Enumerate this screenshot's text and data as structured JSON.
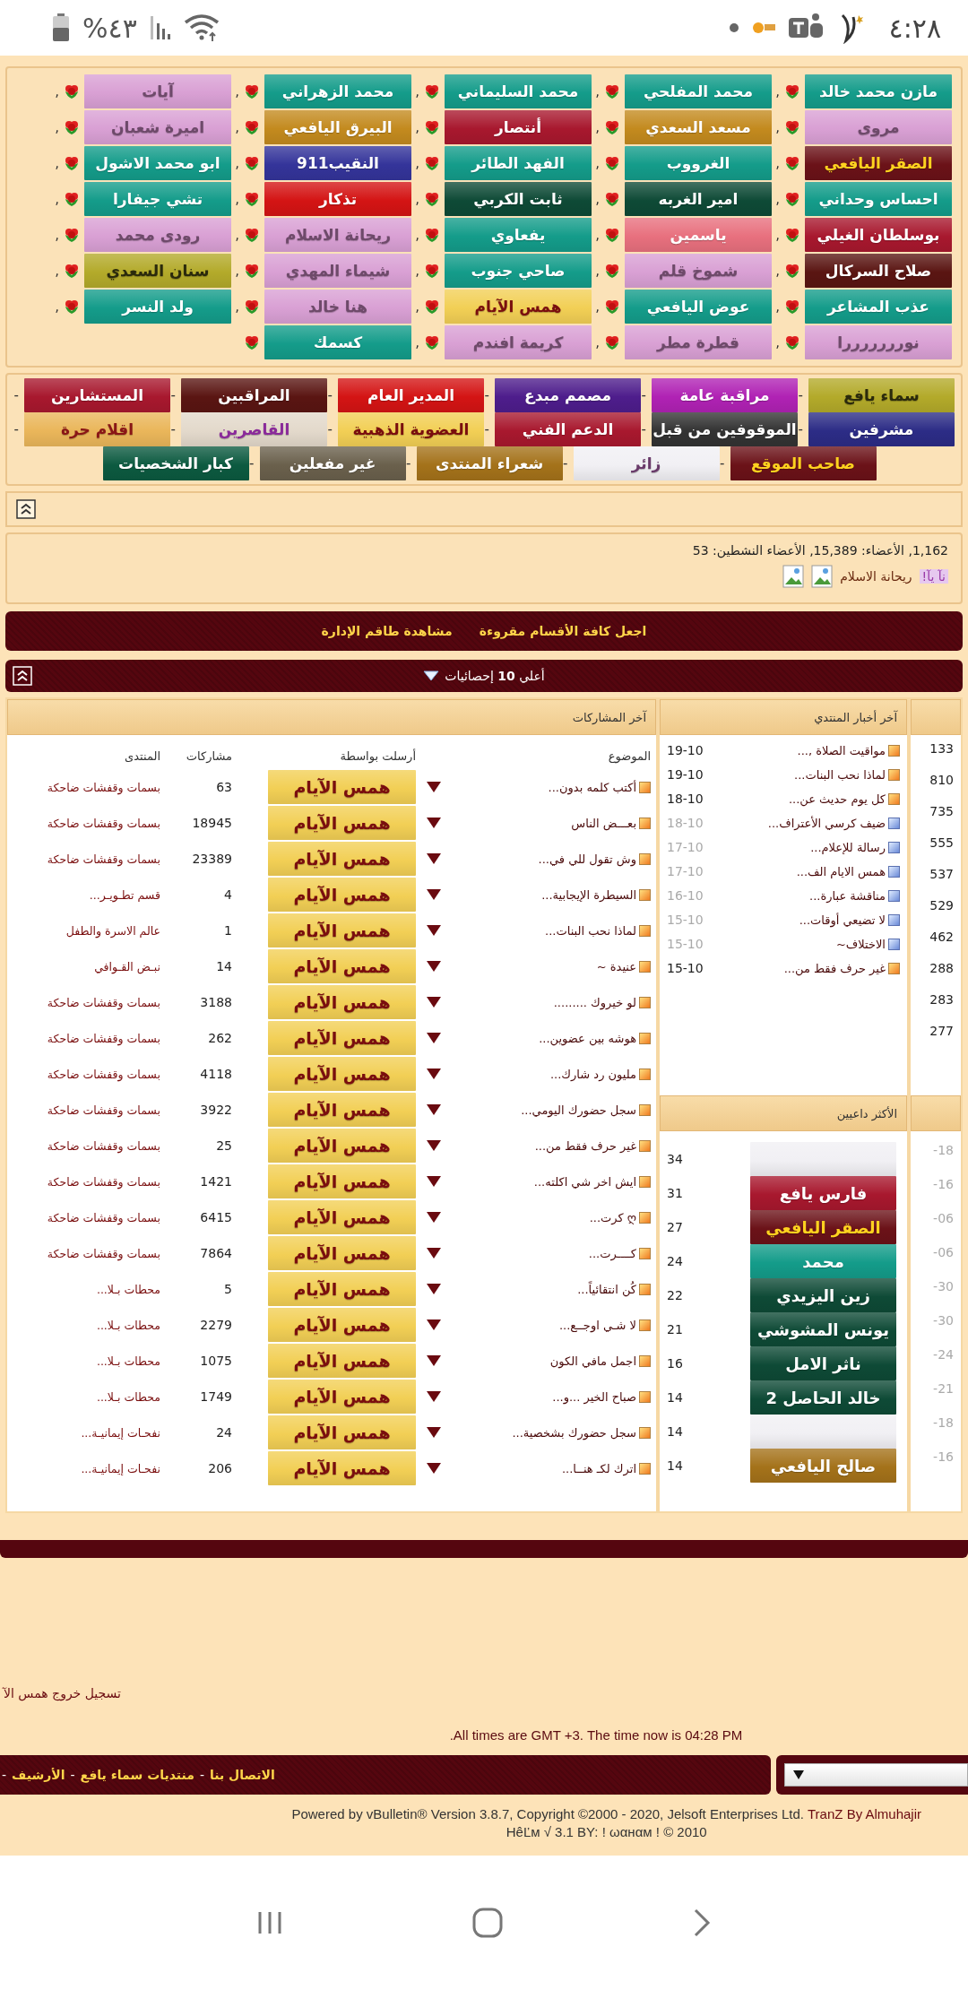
{
  "status_bar": {
    "battery": "%٤٣",
    "time": "٤:٢٨"
  },
  "online_users": [
    {
      "name": "مازن محمد خالد",
      "kind": "teal",
      "sep": ","
    },
    {
      "name": "محمد المفلحي",
      "kind": "teal",
      "sep": ","
    },
    {
      "name": "محمد السليماني",
      "kind": "teal",
      "sep": ","
    },
    {
      "name": "محمد الزهراني",
      "kind": "teal",
      "sep": ","
    },
    {
      "name": "آيات",
      "kind": "pink",
      "sep": ","
    },
    {
      "name": "مروى",
      "kind": "pink",
      "sep": ","
    },
    {
      "name": "مسعد السعدي",
      "kind": "amber",
      "sep": ","
    },
    {
      "name": "أنتصار",
      "kind": "crimson",
      "sep": ","
    },
    {
      "name": "البيرق اليافعي",
      "kind": "amber",
      "sep": ","
    },
    {
      "name": "اميرة شعبان",
      "kind": "pink",
      "sep": ","
    },
    {
      "name": "الصقر اليافعي",
      "kind": "maroon",
      "sep": ","
    },
    {
      "name": "الغرووب",
      "kind": "teal",
      "sep": ","
    },
    {
      "name": "الفهد الطائر",
      "kind": "teal",
      "sep": ","
    },
    {
      "name": "النقيب911",
      "kind": "indigo",
      "sep": ","
    },
    {
      "name": "ابو محمد الاشول",
      "kind": "teal",
      "sep": ","
    },
    {
      "name": "احساس وحداني",
      "kind": "teal",
      "sep": ","
    },
    {
      "name": "امير الغربه",
      "kind": "forest",
      "sep": ","
    },
    {
      "name": "ثابت الكربي",
      "kind": "forest",
      "sep": ","
    },
    {
      "name": "تذكار",
      "kind": "red",
      "sep": ","
    },
    {
      "name": "تشي جيفارا",
      "kind": "teal",
      "sep": ","
    },
    {
      "name": "بوسلطان الغيلي",
      "kind": "crimson",
      "sep": ","
    },
    {
      "name": "ياسمين",
      "kind": "coral",
      "sep": ","
    },
    {
      "name": "يفعاوي",
      "kind": "teal",
      "sep": ","
    },
    {
      "name": "ريحانة الاسلام",
      "kind": "pink",
      "sep": ","
    },
    {
      "name": "رودى محمد",
      "kind": "pink",
      "sep": ","
    },
    {
      "name": "صلاح السركال",
      "kind": "wine",
      "sep": ","
    },
    {
      "name": "شموخ قلم",
      "kind": "pink",
      "sep": ","
    },
    {
      "name": "صاحي جنوب",
      "kind": "teal",
      "sep": ","
    },
    {
      "name": "شيماء المهدي",
      "kind": "pink",
      "sep": ","
    },
    {
      "name": "سنان السعدي",
      "kind": "olive",
      "sep": ","
    },
    {
      "name": "عذب المشاعر",
      "kind": "teal",
      "sep": ","
    },
    {
      "name": "عوض اليافعي",
      "kind": "teal",
      "sep": ","
    },
    {
      "name": "همس الآيام",
      "kind": "gold",
      "sep": ","
    },
    {
      "name": "هنا خالد",
      "kind": "pink",
      "sep": ","
    },
    {
      "name": "ولد النسر",
      "kind": "teal",
      "sep": ","
    },
    {
      "name": "نورررررررا",
      "kind": "pink",
      "sep": ","
    },
    {
      "name": "قطرة مطر",
      "kind": "pink",
      "sep": ","
    },
    {
      "name": "كريمة افندم",
      "kind": "pink",
      "sep": ","
    },
    {
      "name": "كسمك",
      "kind": "teal"
    }
  ],
  "usergroups": [
    {
      "name": "سماء يافع",
      "kind": "olive",
      "sep": "-"
    },
    {
      "name": "مراقبة عامة",
      "kind": "magenta",
      "sep": "-"
    },
    {
      "name": "مصمم مبدع",
      "kind": "purple",
      "sep": "-"
    },
    {
      "name": "المدير العام",
      "kind": "red",
      "sep": "-"
    },
    {
      "name": "المراقبين",
      "kind": "wine",
      "sep": "-"
    },
    {
      "name": "المستشارين",
      "kind": "crimson",
      "sep": "-"
    },
    {
      "name": "مشرفين",
      "kind": "navy",
      "sep": "-"
    },
    {
      "name": "الموقوفين من قبل",
      "kind": "black",
      "sep": "-"
    },
    {
      "name": "الدعم الفني",
      "kind": "crimson",
      "sep": "-"
    },
    {
      "name": "العضوية الذهبية",
      "kind": "gold",
      "sep": "-"
    },
    {
      "name": "القاصرين",
      "kind": "beige",
      "sep": "-"
    },
    {
      "name": "اقلام حرة",
      "kind": "sand",
      "sep": "-"
    },
    {
      "name": "صاحب الموقع",
      "kind": "maroon",
      "sep": "-"
    },
    {
      "name": "زائر",
      "kind": "white",
      "sep": "-"
    },
    {
      "name": "شعراء المنتدى",
      "kind": "bronze",
      "sep": "-"
    },
    {
      "name": "غير مفعلين",
      "kind": "taupe",
      "sep": "-"
    },
    {
      "name": "كبار الشخصيات",
      "kind": "emerald"
    }
  ],
  "stats": {
    "text": "1,162, الأعضاء: 15,389, الأعضاء النشطين: 53",
    "highlight_name": "نآ يآ!",
    "name": "ريحانة الاسلام"
  },
  "action_links": [
    "اجعل كافة الأقسام مقروءة",
    "مشاهدة طاقم الإدارة"
  ],
  "top_stats": {
    "title": "أعلي **10** إحصائيات"
  },
  "latest_posts": {
    "title": "آخر المشاركات",
    "columns": [
      "الموضوع",
      "أرسلت بواسطة",
      "مشاركات",
      "المنتدى"
    ],
    "rows": [
      {
        "topic": "أكتب كلمه بدون...",
        "poster": "همس الآيام",
        "posts": "63",
        "forum": "بسمات وقفشات ضاحكة"
      },
      {
        "topic": "بعـــض الناس",
        "poster": "همس الآيام",
        "posts": "18945",
        "forum": "بسمات وقفشات ضاحكة"
      },
      {
        "topic": "وش تقول للي في...",
        "poster": "همس الآيام",
        "posts": "23389",
        "forum": "بسمات وقفشات ضاحكة"
      },
      {
        "topic": "السيطرة الإيجابية...",
        "poster": "همس الآيام",
        "posts": "4",
        "forum": "قسم تطـويـر..."
      },
      {
        "topic": "لماذا نحب البنات...",
        "poster": "همس الآيام",
        "posts": "1",
        "forum": "عالم الاسرة والطفل"
      },
      {
        "topic": "عنيدة ~",
        "poster": "همس الآيام",
        "posts": "14",
        "forum": "نبـض القـوافي"
      },
      {
        "topic": "لو خيروك .........",
        "poster": "همس الآيام",
        "posts": "3188",
        "forum": "بسمات وقفشات ضاحكة"
      },
      {
        "topic": "هوشه بين عضوين...",
        "poster": "همس الآيام",
        "posts": "262",
        "forum": "بسمات وقفشات ضاحكة"
      },
      {
        "topic": "مليون رد شارك...",
        "poster": "همس الآيام",
        "posts": "4118",
        "forum": "بسمات وقفشات ضاحكة"
      },
      {
        "topic": "سجل حضورك اليومي...",
        "poster": "همس الآيام",
        "posts": "3922",
        "forum": "بسمات وقفشات ضاحكة"
      },
      {
        "topic": "غير حرف فقط من...",
        "poster": "همس الآيام",
        "posts": "25",
        "forum": "بسمات وقفشات ضاحكة"
      },
      {
        "topic": "ايش اخر شي اكلته...",
        "poster": "همس الآيام",
        "posts": "1421",
        "forum": "بسمات وقفشات ضاحكة"
      },
      {
        "topic": "ღ كرت...",
        "poster": "همس الآيام",
        "posts": "6415",
        "forum": "بسمات وقفشات ضاحكة"
      },
      {
        "topic": "كــــرت...",
        "poster": "همس الآيام",
        "posts": "7864",
        "forum": "بسمات وقفشات ضاحكة"
      },
      {
        "topic": "كُن انتقائياً...",
        "poster": "همس الآيام",
        "posts": "5",
        "forum": "محطات بـلا..."
      },
      {
        "topic": "لا شـي اوجــع...",
        "poster": "همس الآيام",
        "posts": "2279",
        "forum": "محطات بـلا..."
      },
      {
        "topic": "اجمل مافي الكون",
        "poster": "همس الآيام",
        "posts": "1075",
        "forum": "محطات بـلا..."
      },
      {
        "topic": "صباح الخير ...و...",
        "poster": "همس الآيام",
        "posts": "1749",
        "forum": "محطات بـلا..."
      },
      {
        "topic": "سجل حضورك بشخصية...",
        "poster": "همس الآيام",
        "posts": "24",
        "forum": "نفحـات إيمانيـة..."
      },
      {
        "topic": "اترك لكـ هنــا...",
        "poster": "همس الآيام",
        "posts": "206",
        "forum": "نفحـات إيمانيـة..."
      }
    ]
  },
  "forum_news": {
    "title": "آخر أخبار المنتدي",
    "rows": [
      {
        "title": "مواقيت الصلاة ,...",
        "date": "19-10",
        "unread": true
      },
      {
        "title": "لماذا نحب البنات...",
        "date": "19-10",
        "unread": true
      },
      {
        "title": "كل يوم حديث عن...",
        "date": "18-10",
        "unread": true
      },
      {
        "title": "ضيف كرسي الأعتراف...",
        "date": "18-10",
        "unread": false
      },
      {
        "title": "رسالة للإعلام...",
        "date": "17-10",
        "unread": false
      },
      {
        "title": "همس الايام الف...",
        "date": "17-10",
        "unread": false
      },
      {
        "title": "مناقشة عبارة...",
        "date": "16-10",
        "unread": false
      },
      {
        "title": "لا تضيعي أوقات...",
        "date": "15-10",
        "unread": false
      },
      {
        "title": "الاختلاف~",
        "date": "15-10",
        "unread": false
      },
      {
        "title": "غير حرف فقط من...",
        "date": "15-10",
        "unread": true
      }
    ]
  },
  "top_inviters": {
    "title": "الأكثر داعيين",
    "rows": [
      {
        "count": "34",
        "kind": "white"
      },
      {
        "count": "31",
        "name": "فارس يافع",
        "kind": "crimson"
      },
      {
        "count": "27",
        "name": "الصقر اليافعي",
        "kind": "maroon"
      },
      {
        "count": "24",
        "name": "محمد",
        "kind": "teal"
      },
      {
        "count": "22",
        "name": "زين اليزيدي",
        "kind": "forest"
      },
      {
        "count": "21",
        "name": "يونس المشوشي",
        "kind": "forest"
      },
      {
        "count": "16",
        "name": "ناثر الامل",
        "kind": "forest"
      },
      {
        "count": "14",
        "name": "خالد الحاصل 2",
        "kind": "forest"
      },
      {
        "count": "14",
        "kind": "white"
      },
      {
        "count": "14",
        "name": "صالح اليافعي",
        "kind": "bronze"
      }
    ]
  },
  "column_3": {
    "upper": [
      "133",
      "810",
      "735",
      "555",
      "537",
      "529",
      "462",
      "288",
      "283",
      "277"
    ],
    "lower": [
      "18-",
      "16-",
      "06-",
      "06-",
      "30-",
      "30-",
      "24-",
      "21-",
      "18-",
      "16-"
    ]
  },
  "footer": {
    "logout": "تسجيل خروج همس الآ",
    "time_note": "All times are GMT +3. The time now is 04:28 PM.",
    "links": [
      {
        "label": "الاتصال بنا",
        "sep": "-"
      },
      {
        "label": "منتديات سماء يافع",
        "sep": "-"
      },
      {
        "label": "الأرشيف",
        "sep": "-"
      }
    ],
    "powered": "Powered by vBulletin® Version 3.8.7, Copyright ©2000 - 2020, Jelsoft Enterprises Ltd.",
    "tranz": "TranZ By Almuhajir",
    "hack": "HêĽм √ 3.1 BY: ! ωαнαм ! © 2010"
  }
}
